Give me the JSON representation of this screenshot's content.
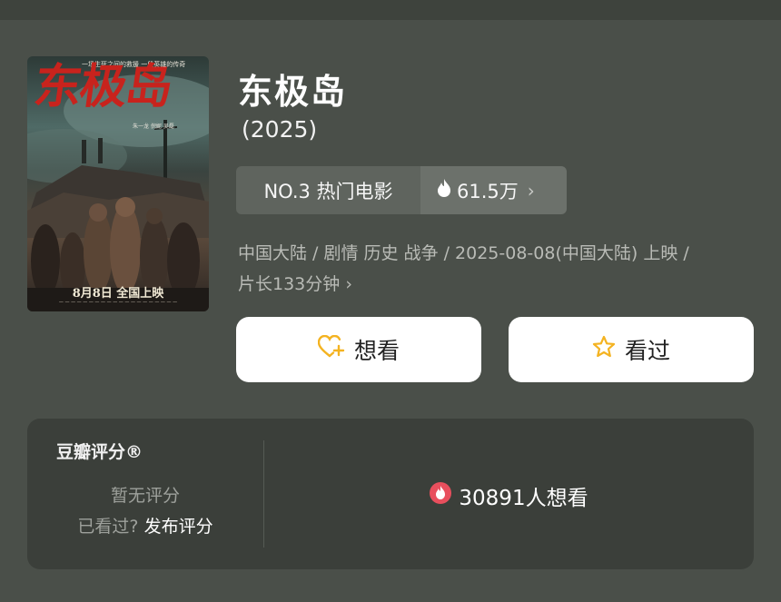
{
  "movie": {
    "title": "东极岛",
    "year": "(2025)",
    "rank_label": "NO.3 热门电影",
    "heat": "61.5万",
    "info_line1": "中国大陆 / 剧情 历史 战争 / 2025-08-08(中国大陆) 上映 /",
    "info_line2": "片长133分钟"
  },
  "poster": {
    "title_text": "东极岛",
    "top_text": "一场生死之间的救援 一段英雄的传奇",
    "credit_text": "朱一龙 倪妮 吴磊",
    "release_text": "8月8日 全国上映"
  },
  "actions": {
    "want_label": "想看",
    "seen_label": "看过"
  },
  "rating": {
    "title": "豆瓣评分®",
    "no_rating": "暂无评分",
    "seen_prompt": "已看过?",
    "publish_label": "发布评分",
    "wish_count": "30891人想看"
  },
  "colors": {
    "background": "#4a4f49",
    "card": "#3b3f3a",
    "accent_yellow": "#f4b321",
    "heat_red": "#e84f5d"
  },
  "icons": {
    "heat": "flame-icon",
    "want": "heart-plus-icon",
    "seen": "star-icon",
    "wish": "flame-badge-icon",
    "more": "chevron-right-icon"
  }
}
